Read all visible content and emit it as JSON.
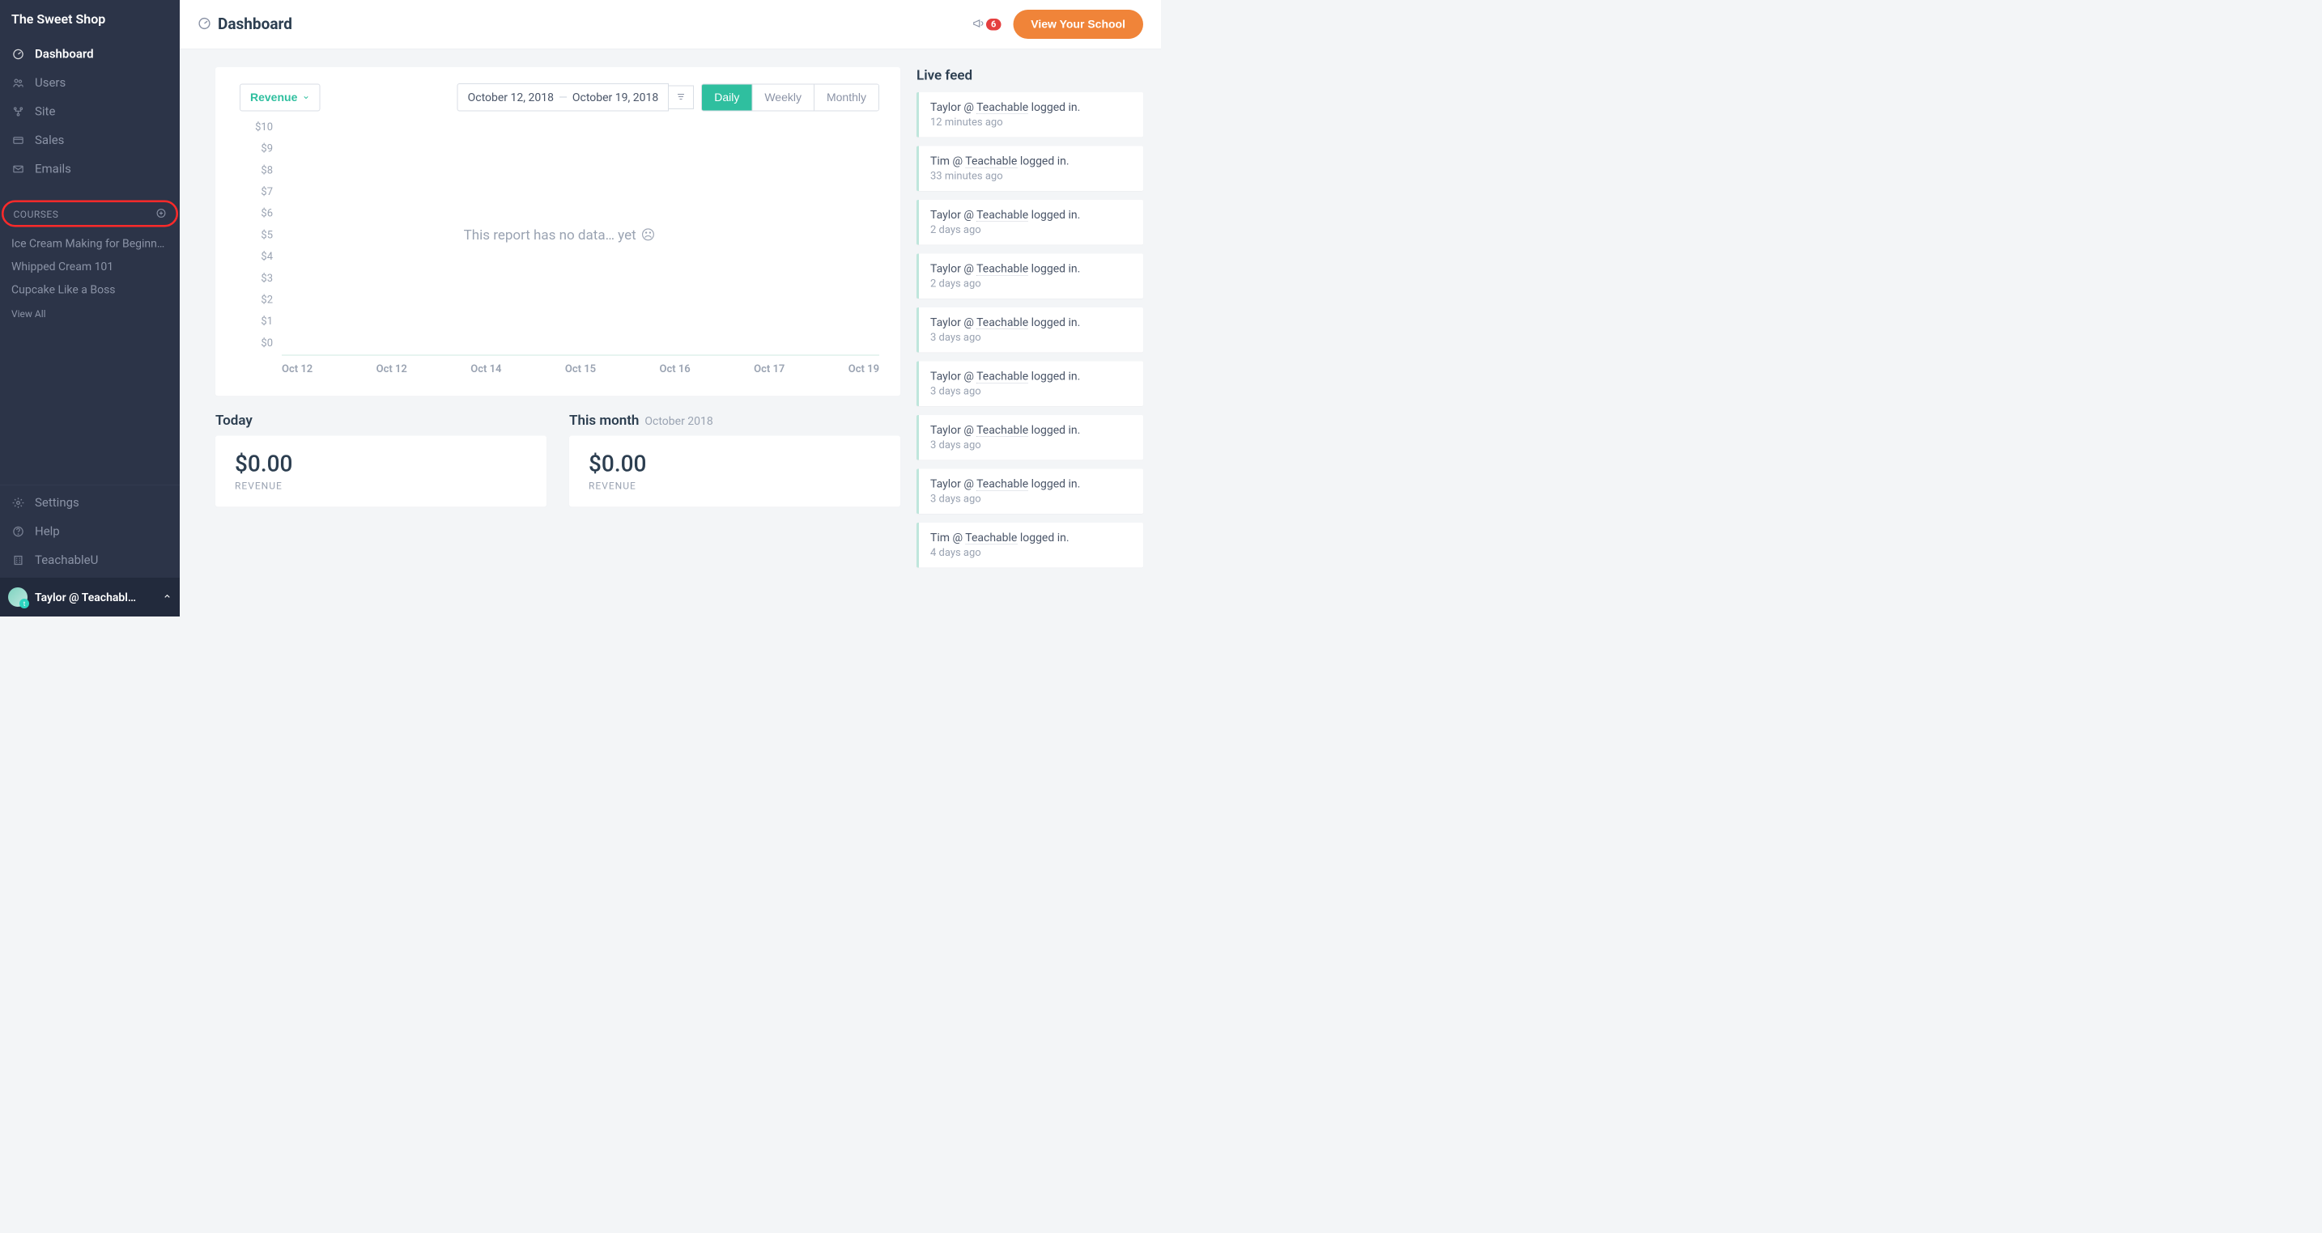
{
  "brand": "The Sweet Shop",
  "nav": {
    "dashboard": "Dashboard",
    "users": "Users",
    "site": "Site",
    "sales": "Sales",
    "emails": "Emails"
  },
  "courses_section": {
    "label": "COURSES",
    "items": [
      "Ice Cream Making for Beginn…",
      "Whipped Cream 101",
      "Cupcake Like a Boss"
    ],
    "view_all": "View All"
  },
  "footer_nav": {
    "settings": "Settings",
    "help": "Help",
    "teachableu": "TeachableU"
  },
  "user": "Taylor @ Teachabl…",
  "page_title": "Dashboard",
  "notif_count": "6",
  "view_school_btn": "View Your School",
  "chart": {
    "dropdown_label": "Revenue",
    "date_start": "October 12, 2018",
    "date_end": "October 19, 2018",
    "seg_daily": "Daily",
    "seg_weekly": "Weekly",
    "seg_monthly": "Monthly",
    "empty_msg": "This report has no data… yet"
  },
  "chart_data": {
    "type": "line",
    "title": "",
    "xlabel": "",
    "ylabel": "",
    "ylim": [
      0,
      10
    ],
    "y_ticks": [
      "$10",
      "$9",
      "$8",
      "$7",
      "$6",
      "$5",
      "$4",
      "$3",
      "$2",
      "$1",
      "$0"
    ],
    "categories": [
      "Oct 12",
      "Oct 12",
      "Oct 14",
      "Oct 15",
      "Oct 16",
      "Oct 17",
      "Oct 19"
    ],
    "series": [
      {
        "name": "Revenue",
        "values": [
          0,
          0,
          0,
          0,
          0,
          0,
          0
        ]
      }
    ]
  },
  "stats": {
    "today_label": "Today",
    "today_value": "$0.00",
    "today_metric": "REVENUE",
    "month_label": "This month",
    "month_sub": "October 2018",
    "month_value": "$0.00",
    "month_metric": "REVENUE"
  },
  "feed": {
    "title": "Live feed",
    "items": [
      {
        "who": "Taylor",
        "org": "Teachable",
        "action": "logged in.",
        "time": "12 minutes ago"
      },
      {
        "who": "Tim",
        "org": "Teachable",
        "action": "logged in.",
        "time": "33 minutes ago"
      },
      {
        "who": "Taylor",
        "org": "Teachable",
        "action": "logged in.",
        "time": "2 days ago"
      },
      {
        "who": "Taylor",
        "org": "Teachable",
        "action": "logged in.",
        "time": "2 days ago"
      },
      {
        "who": "Taylor",
        "org": "Teachable",
        "action": "logged in.",
        "time": "3 days ago"
      },
      {
        "who": "Taylor",
        "org": "Teachable",
        "action": "logged in.",
        "time": "3 days ago"
      },
      {
        "who": "Taylor",
        "org": "Teachable",
        "action": "logged in.",
        "time": "3 days ago"
      },
      {
        "who": "Taylor",
        "org": "Teachable",
        "action": "logged in.",
        "time": "3 days ago"
      },
      {
        "who": "Tim",
        "org": "Teachable",
        "action": "logged in.",
        "time": "4 days ago"
      }
    ]
  }
}
